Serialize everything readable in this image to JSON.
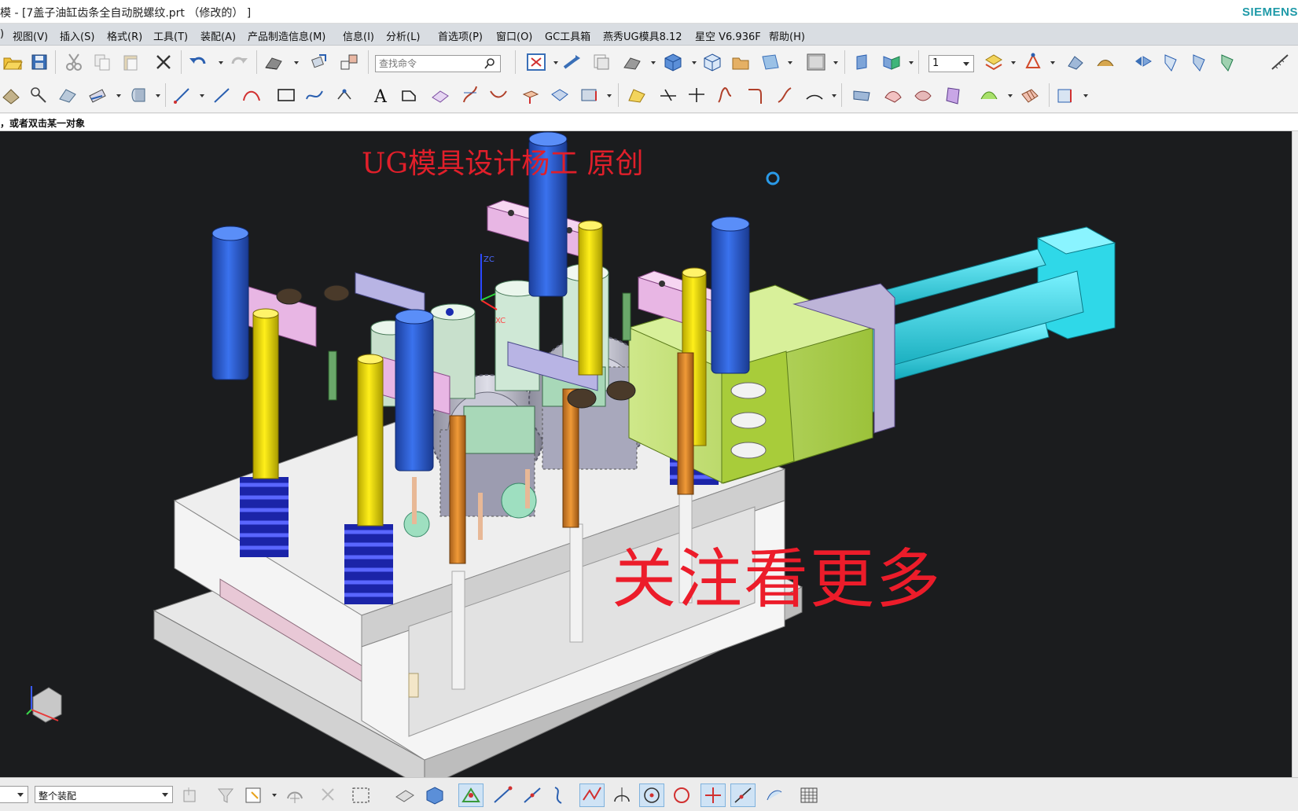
{
  "window": {
    "title": "模 - [7盖子油缸齿条全自动脱螺纹.prt （修改的） ]",
    "brand": "SIEMENS"
  },
  "menu": [
    "视图(V)",
    "插入(S)",
    "格式(R)",
    "工具(T)",
    "装配(A)",
    "产品制造信息(M)",
    "信息(I)",
    "分析(L)",
    "首选项(P)",
    "窗口(O)",
    "GC工具箱",
    "燕秀UG模具8.12",
    "星空 V6.936F",
    "帮助(H)"
  ],
  "toolbar": {
    "search_placeholder": "查找命令",
    "layer_value": "1"
  },
  "cue_line": "，或者双击某一对象",
  "viewport": {
    "watermark_top": "UG模具设计杨工 原创",
    "watermark_bottom": "关注看更多",
    "axis_labels": {
      "zc": "ZC",
      "xc": "XC"
    },
    "colors": {
      "background": "#1b1c1e",
      "ejector_blue": "#2b5fd8",
      "guide_yellow": "#f2e200",
      "gear_silver": "#b8b8c8",
      "plate_white": "#ececec",
      "cylinder_cyan": "#19cfe0",
      "block_green": "#b8e23a",
      "bracket_pink": "#e8b6e4",
      "rod_orange": "#e08a24",
      "spring_blue": "#2a35d8"
    }
  },
  "statusbar": {
    "filter_value": "",
    "assembly_value": "整个装配"
  }
}
